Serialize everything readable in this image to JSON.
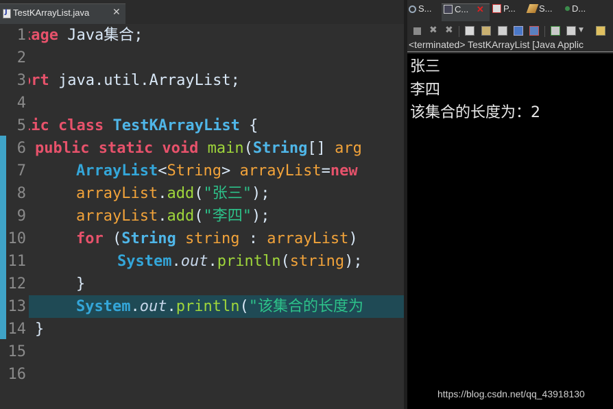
{
  "editor": {
    "tab": {
      "label": "TestKArrayList.java",
      "close": "✕"
    },
    "line_numbers": [
      "1",
      "2",
      "3",
      "4",
      "5",
      "6",
      "7",
      "8",
      "9",
      "10",
      "11",
      "12",
      "13",
      "14",
      "15",
      "16"
    ],
    "code": {
      "l1_kw": "kage",
      "l1_rest": " Java集合;",
      "l3_kw": "ort",
      "l3_rest": " java.util.ArrayList;",
      "l5_kw": "lic class",
      "l5_cls": "TestKArrayList",
      "l5_rest": " {",
      "l6_kw": "public static void",
      "l6_mth": "main",
      "l6_p1": "(",
      "l6_ty": "String",
      "l6_p2": "[] ",
      "l6_var": "arg",
      "l7_cls": "ArrayList",
      "l7_p1": "<",
      "l7_cls2": "String",
      "l7_p2": "> ",
      "l7_var": "arrayList",
      "l7_p3": "=",
      "l7_kw": "new",
      "l8_var": "arrayList",
      "l8_p1": ".",
      "l8_mth": "add",
      "l8_p2": "(",
      "l8_str": "\"张三\"",
      "l8_p3": ");",
      "l9_var": "arrayList",
      "l9_p1": ".",
      "l9_mth": "add",
      "l9_p2": "(",
      "l9_str": "\"李四\"",
      "l9_p3": ");",
      "l10_kw": "for",
      "l10_p1": " (",
      "l10_ty": "String",
      "l10_p2": " ",
      "l10_var": "string",
      "l10_p3": " : ",
      "l10_var2": "arrayList",
      "l10_p4": ")",
      "l11_cls": "System",
      "l11_p1": ".",
      "l11_it": "out",
      "l11_p2": ".",
      "l11_mth": "println",
      "l11_p3": "(",
      "l11_var": "string",
      "l11_p4": ");",
      "l12": "}",
      "l13_cls": "System",
      "l13_p1": ".",
      "l13_it": "out",
      "l13_p2": ".",
      "l13_mth": "println",
      "l13_p3": "(",
      "l13_str": "\"该集合的长度为",
      "l14": "}"
    },
    "colors": {
      "keyword": "#e7526b",
      "type": "#4fb6e8",
      "variable": "#f2a33a",
      "method": "#9fd63b",
      "string": "#2dc28a",
      "highlight_row": "#1f4a55",
      "change_ruler": "#3fa3c7"
    }
  },
  "console": {
    "tabs": [
      {
        "label": "S...",
        "icon": "search-icon"
      },
      {
        "label": "C...",
        "icon": "console-icon",
        "close": "✕"
      },
      {
        "label": "P...",
        "icon": "problems-icon"
      },
      {
        "label": "S...",
        "icon": "snippets-icon"
      },
      {
        "label": "D...",
        "icon": "debug-icon"
      }
    ],
    "toolbar_icons": [
      "terminate-icon",
      "remove-launch-icon",
      "remove-all-icon",
      "clear-console-icon",
      "scroll-lock-icon",
      "word-wrap-icon",
      "show-on-stdout-icon",
      "show-on-stderr-icon",
      "pin-console-icon",
      "display-console-icon",
      "new-console-icon"
    ],
    "status": "<terminated> TestKArrayList [Java Applic",
    "output": [
      "张三",
      "李四",
      "该集合的长度为：2"
    ]
  },
  "watermark": "https://blog.csdn.net/qq_43918130"
}
